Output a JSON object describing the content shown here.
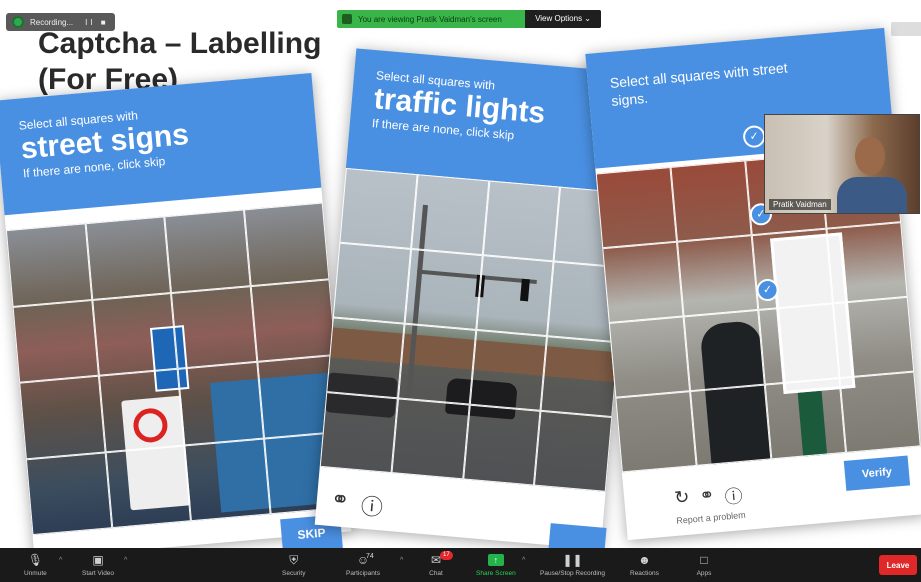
{
  "recording": {
    "label": "Recording...",
    "controls": "II ■"
  },
  "share_banner": {
    "text": "You are viewing Pratik Vaidman's screen",
    "view_options": "View Options ⌄"
  },
  "top_right_badge": "",
  "slide": {
    "title_line1": "Captcha – Labelling",
    "title_line2": "(For Free)"
  },
  "captcha_1": {
    "instruction_small": "Select all squares with",
    "target": "street signs",
    "hint": "If there are none, click skip",
    "button": "SKIP"
  },
  "captcha_2": {
    "instruction_small": "Select all squares with",
    "target": "traffic lights",
    "hint": "If there are none, click skip",
    "icons": [
      "headphones-icon",
      "info-icon"
    ]
  },
  "captcha_3": {
    "instruction": "Select all squares with street signs.",
    "icons": [
      "reload-icon",
      "headphones-icon",
      "info-icon"
    ],
    "report": "Report a problem",
    "button": "Verify"
  },
  "webcam": {
    "name": "Pratik Vaidman"
  },
  "toolbar": {
    "unmute": "Unmute",
    "start_video": "Start Video",
    "security": "Security",
    "participants": "Participants",
    "participants_count": "74",
    "chat": "Chat",
    "chat_badge": "17",
    "share_screen": "Share Screen",
    "pause_recording": "Pause/Stop Recording",
    "reactions": "Reactions",
    "apps": "Apps",
    "leave": "Leave"
  }
}
